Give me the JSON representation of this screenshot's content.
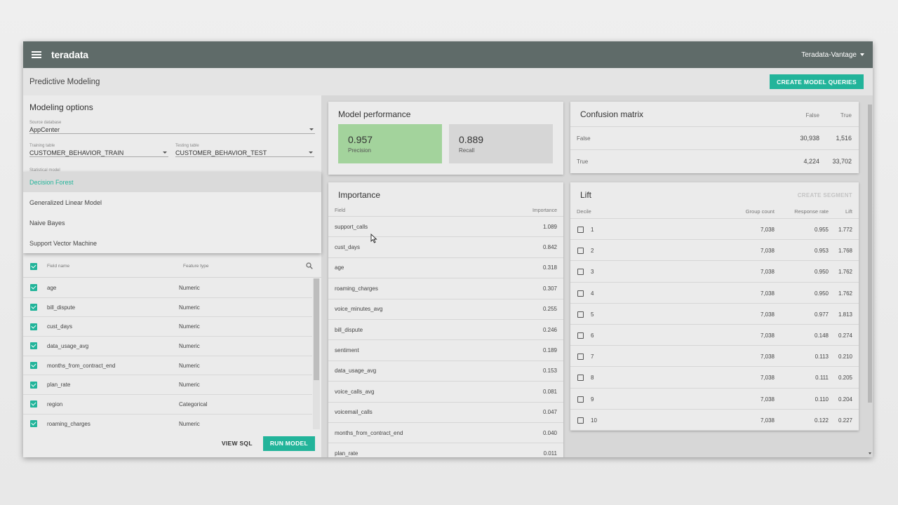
{
  "app": {
    "logo": "teradata",
    "account": "Teradata-Vantage"
  },
  "subbar": {
    "title": "Predictive Modeling",
    "create_queries": "CREATE MODEL QUERIES"
  },
  "modeling": {
    "title": "Modeling options",
    "source_label": "Source database",
    "source_value": "AppCenter",
    "training_label": "Training table",
    "training_value": "CUSTOMER_BEHAVIOR_TRAIN",
    "testing_label": "Testing table",
    "testing_value": "CUSTOMER_BEHAVIOR_TEST",
    "model_label_partial": "Statistical model",
    "models": [
      "Decision Forest",
      "Generalized Linear Model",
      "Naive Bayes",
      "Support Vector Machine"
    ],
    "fields_header": {
      "name": "Field name",
      "type": "Feature type"
    },
    "fields": [
      {
        "name": "age",
        "type": "Numeric"
      },
      {
        "name": "bill_dispute",
        "type": "Numeric"
      },
      {
        "name": "cust_days",
        "type": "Numeric"
      },
      {
        "name": "data_usage_avg",
        "type": "Numeric"
      },
      {
        "name": "months_from_contract_end",
        "type": "Numeric"
      },
      {
        "name": "plan_rate",
        "type": "Numeric"
      },
      {
        "name": "region",
        "type": "Categorical"
      },
      {
        "name": "roaming_charges",
        "type": "Numeric"
      }
    ],
    "view_sql": "VIEW SQL",
    "run_model": "RUN MODEL"
  },
  "performance": {
    "title": "Model performance",
    "precision_value": "0.957",
    "precision_label": "Precision",
    "recall_value": "0.889",
    "recall_label": "Recall"
  },
  "confusion": {
    "title": "Confusion matrix",
    "col_false": "False",
    "col_true": "True",
    "rows": [
      {
        "label": "False",
        "false": "30,938",
        "true": "1,516"
      },
      {
        "label": "True",
        "false": "4,224",
        "true": "33,702"
      }
    ]
  },
  "importance": {
    "title": "Importance",
    "col_field": "Field",
    "col_importance": "Importance",
    "rows": [
      {
        "field": "support_calls",
        "value": "1.089"
      },
      {
        "field": "cust_days",
        "value": "0.842"
      },
      {
        "field": "age",
        "value": "0.318"
      },
      {
        "field": "roaming_charges",
        "value": "0.307"
      },
      {
        "field": "voice_minutes_avg",
        "value": "0.255"
      },
      {
        "field": "bill_dispute",
        "value": "0.246"
      },
      {
        "field": "sentiment",
        "value": "0.189"
      },
      {
        "field": "data_usage_avg",
        "value": "0.153"
      },
      {
        "field": "voice_calls_avg",
        "value": "0.081"
      },
      {
        "field": "voicemail_calls",
        "value": "0.047"
      },
      {
        "field": "months_from_contract_end",
        "value": "0.040"
      },
      {
        "field": "plan_rate",
        "value": "0.011"
      }
    ]
  },
  "lift": {
    "title": "Lift",
    "create_segment": "CREATE SEGMENT",
    "col_decile": "Decile",
    "col_group": "Group count",
    "col_response": "Response rate",
    "col_lift": "Lift",
    "rows": [
      {
        "decile": "1",
        "group": "7,038",
        "response": "0.955",
        "lift": "1.772"
      },
      {
        "decile": "2",
        "group": "7,038",
        "response": "0.953",
        "lift": "1.768"
      },
      {
        "decile": "3",
        "group": "7,038",
        "response": "0.950",
        "lift": "1.762"
      },
      {
        "decile": "4",
        "group": "7,038",
        "response": "0.950",
        "lift": "1.762"
      },
      {
        "decile": "5",
        "group": "7,038",
        "response": "0.977",
        "lift": "1.813"
      },
      {
        "decile": "6",
        "group": "7,038",
        "response": "0.148",
        "lift": "0.274"
      },
      {
        "decile": "7",
        "group": "7,038",
        "response": "0.113",
        "lift": "0.210"
      },
      {
        "decile": "8",
        "group": "7,038",
        "response": "0.111",
        "lift": "0.205"
      },
      {
        "decile": "9",
        "group": "7,038",
        "response": "0.110",
        "lift": "0.204"
      },
      {
        "decile": "10",
        "group": "7,038",
        "response": "0.122",
        "lift": "0.227"
      }
    ]
  },
  "colors": {
    "accent": "#22b49a",
    "topbar": "#5f6b69",
    "precision_tile": "#a3d39c"
  }
}
